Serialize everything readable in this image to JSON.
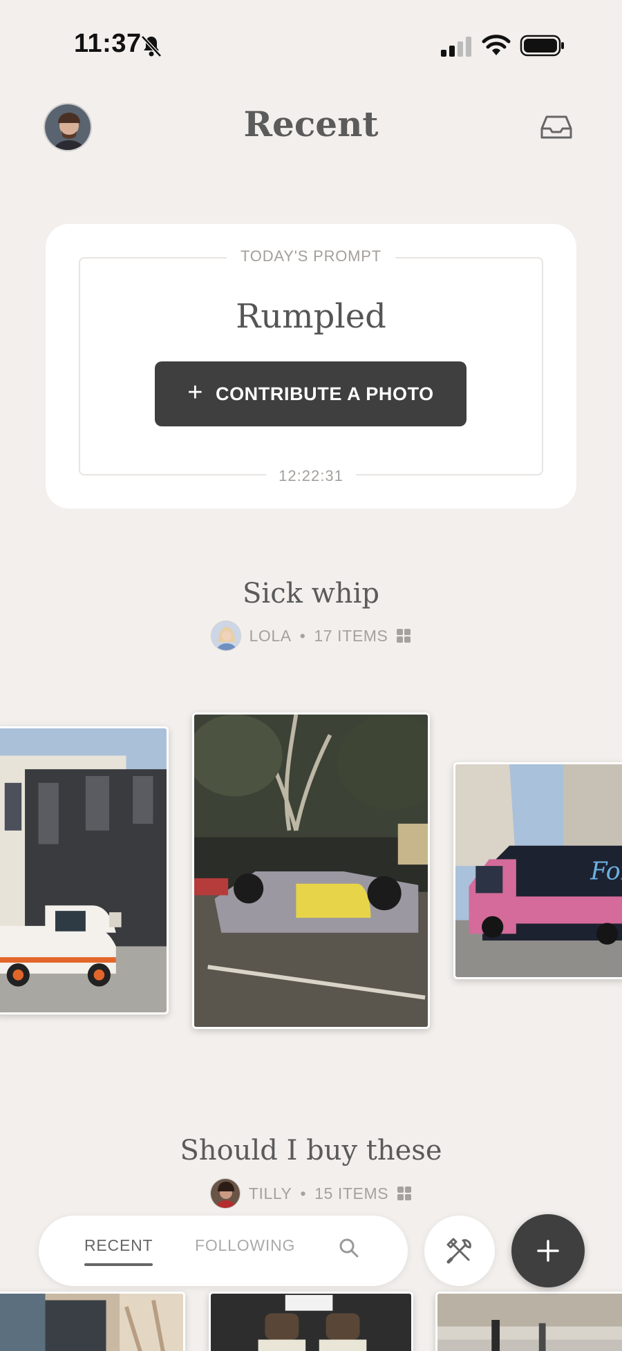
{
  "status_bar": {
    "time": "11:37"
  },
  "header": {
    "title": "Recent"
  },
  "prompt": {
    "label": "TODAY'S PROMPT",
    "word": "Rumpled",
    "contribute_label": "CONTRIBUTE A PHOTO",
    "timer": "12:22:31"
  },
  "collections": [
    {
      "title": "Sick whip",
      "user": "LOLA",
      "separator": "•",
      "count": "17 ITEMS"
    },
    {
      "title": "Should I buy these",
      "user": "TILLY",
      "separator": "•",
      "count": "15 ITEMS"
    }
  ],
  "tabs": {
    "recent": "RECENT",
    "following": "FOLLOWING"
  },
  "colors": {
    "background": "#f2efec",
    "button_dark": "#3f3f3f",
    "card": "#ffffff"
  },
  "icons": [
    "bell-slash-icon",
    "signal-icon",
    "wifi-icon",
    "battery-icon",
    "inbox-icon",
    "grid-icon",
    "search-icon",
    "tools-icon",
    "plus-icon"
  ]
}
